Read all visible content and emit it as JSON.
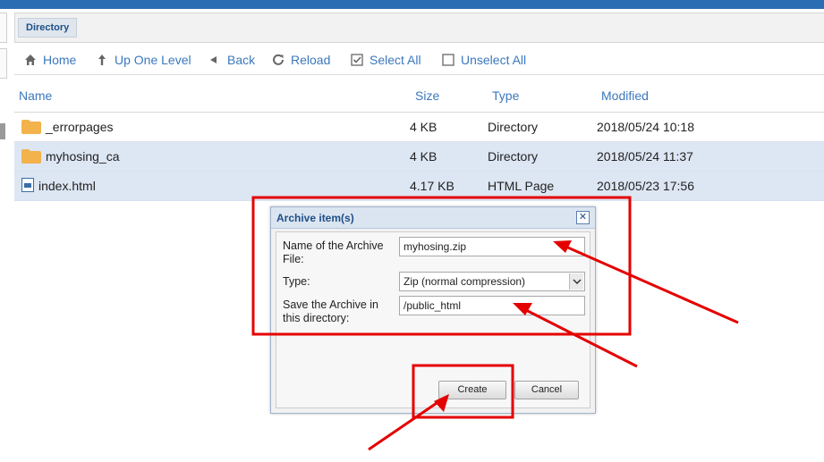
{
  "tabs": {
    "directory": "Directory"
  },
  "toolbar": {
    "home": "Home",
    "up": "Up One Level",
    "back": "Back",
    "reload": "Reload",
    "select_all": "Select All",
    "unselect_all": "Unselect All"
  },
  "table": {
    "headers": {
      "name": "Name",
      "size": "Size",
      "type": "Type",
      "modified": "Modified"
    },
    "rows": [
      {
        "name": "_errorpages",
        "size": "4 KB",
        "type": "Directory",
        "modified": "2018/05/24 10:18",
        "selected": false,
        "icon": "folder-icon"
      },
      {
        "name": "myhosing_ca",
        "size": "4 KB",
        "type": "Directory",
        "modified": "2018/05/24 11:37",
        "selected": true,
        "icon": "folder-icon"
      },
      {
        "name": "index.html",
        "size": "4.17 KB",
        "type": "HTML Page",
        "modified": "2018/05/23 17:56",
        "selected": true,
        "icon": "html-file-icon"
      }
    ]
  },
  "dialog": {
    "title": "Archive item(s)",
    "close": "✕",
    "name_label_1": "Name of the Archive",
    "name_label_2": "File:",
    "name_value": "myhosing.zip",
    "type_label": "Type:",
    "type_value": "Zip (normal compression)",
    "dir_label_1": "Save the Archive in",
    "dir_label_2": "this directory:",
    "dir_value": "/public_html",
    "create": "Create",
    "cancel": "Cancel"
  },
  "colors": {
    "accent": "#3b78bd",
    "topbar": "#2a6db3",
    "selected_row": "#dde6f3",
    "annotation": "#e50000",
    "folder": "#f2b24c"
  }
}
